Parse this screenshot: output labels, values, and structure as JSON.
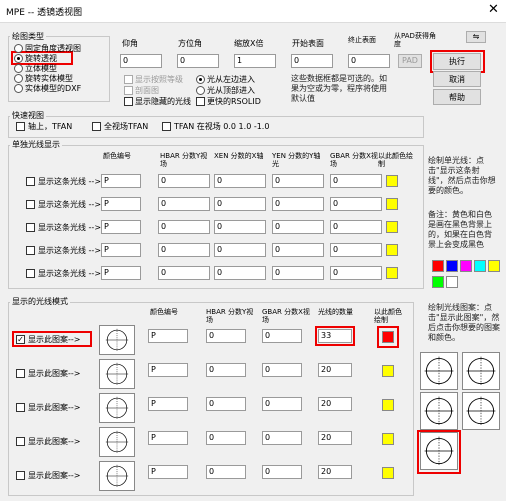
{
  "window": {
    "title": "MPE -- 透镜透视图",
    "close": "✕"
  },
  "plot_type": {
    "label": "绘图类型",
    "options": [
      "固定角度透视图",
      "旋转透视",
      "立体模型",
      "旋转实体模型",
      "实体模型的DXF"
    ],
    "selected": 1
  },
  "headers": {
    "elevation": "仰角",
    "azimuth": "方位角",
    "scale": "缩放X倍",
    "start_surface": "开始表面",
    "end_surface": "终止表面",
    "pad_angle": "从PAD获得角度"
  },
  "values": {
    "elevation": "0",
    "azimuth": "0",
    "scale": "1",
    "start_surface": "0",
    "end_surface": "0"
  },
  "pad_button": "PAD",
  "actions": {
    "execute": "执行",
    "cancel": "取消",
    "help": "帮助"
  },
  "display_opts": {
    "show_grade": "显示按照等级",
    "section": "剖面图",
    "hide_hidden": "显示隐藏的光线",
    "left_enter": "光从左边进入",
    "top_enter": "光从顶部进入",
    "faster_rsolid": "更快的RSOLID"
  },
  "note_top": "这些数据框都是可选的。如果为空或为零，程序将使用默认值",
  "quick_view": {
    "label": "快速视图",
    "items": [
      "轴上，TFAN",
      "全视场TFAN",
      "TFAN 在视场 0.0 1.0 -1.0"
    ]
  },
  "single_ray": {
    "label": "单独光线显示",
    "headers": [
      "颜色编号",
      "HBAR 分数Y视场",
      "XEN 分数的X轴",
      "YEN 分数的Y轴光",
      "GBAR 分数X视场",
      "以此颜色绘制"
    ],
    "row_label": "显示这条光线 -->",
    "rows": [
      {
        "color": "P",
        "hbar": "0",
        "xen": "0",
        "yen": "0",
        "gbar": "0"
      },
      {
        "color": "P",
        "hbar": "0",
        "xen": "0",
        "yen": "0",
        "gbar": "0"
      },
      {
        "color": "P",
        "hbar": "0",
        "xen": "0",
        "yen": "0",
        "gbar": "0"
      },
      {
        "color": "P",
        "hbar": "0",
        "xen": "0",
        "yen": "0",
        "gbar": "0"
      },
      {
        "color": "P",
        "hbar": "0",
        "xen": "0",
        "yen": "0",
        "gbar": "0"
      }
    ]
  },
  "pattern_group": {
    "label": "显示的光线模式",
    "headers": [
      "颜色编号",
      "HBAR 分数Y视场",
      "GBAR 分数X视场",
      "光线的数量",
      "以此颜色绘制"
    ],
    "row_label": "显示此图案-->",
    "rows": [
      {
        "checked": true,
        "color": "P",
        "hbar": "0",
        "gbar": "0",
        "count": "33"
      },
      {
        "checked": false,
        "color": "P",
        "hbar": "0",
        "gbar": "0",
        "count": "20"
      },
      {
        "checked": false,
        "color": "P",
        "hbar": "0",
        "gbar": "0",
        "count": "20"
      },
      {
        "checked": false,
        "color": "P",
        "hbar": "0",
        "gbar": "0",
        "count": "20"
      },
      {
        "checked": false,
        "color": "P",
        "hbar": "0",
        "gbar": "0",
        "count": "20"
      }
    ]
  },
  "notes": {
    "single_ray": "绘制单光线：点击\"显示这条射线\"，然后点击你想要的颜色。",
    "colors": "备注：黄色和白色是画在黑色背景上的，如果在白色背景上会变成黑色",
    "pattern": "绘制光线图案：点击\"显示此图案\"，然后点击你想要的图案和颜色。"
  },
  "palette": [
    "#ff0000",
    "#0000ff",
    "#ff00ff",
    "#00ffff",
    "#ffff00",
    "#00ff00",
    "#ffffff"
  ],
  "colors": {
    "yellow": "#ffff00",
    "red": "#ff0000",
    "highlight": "#e00000"
  }
}
